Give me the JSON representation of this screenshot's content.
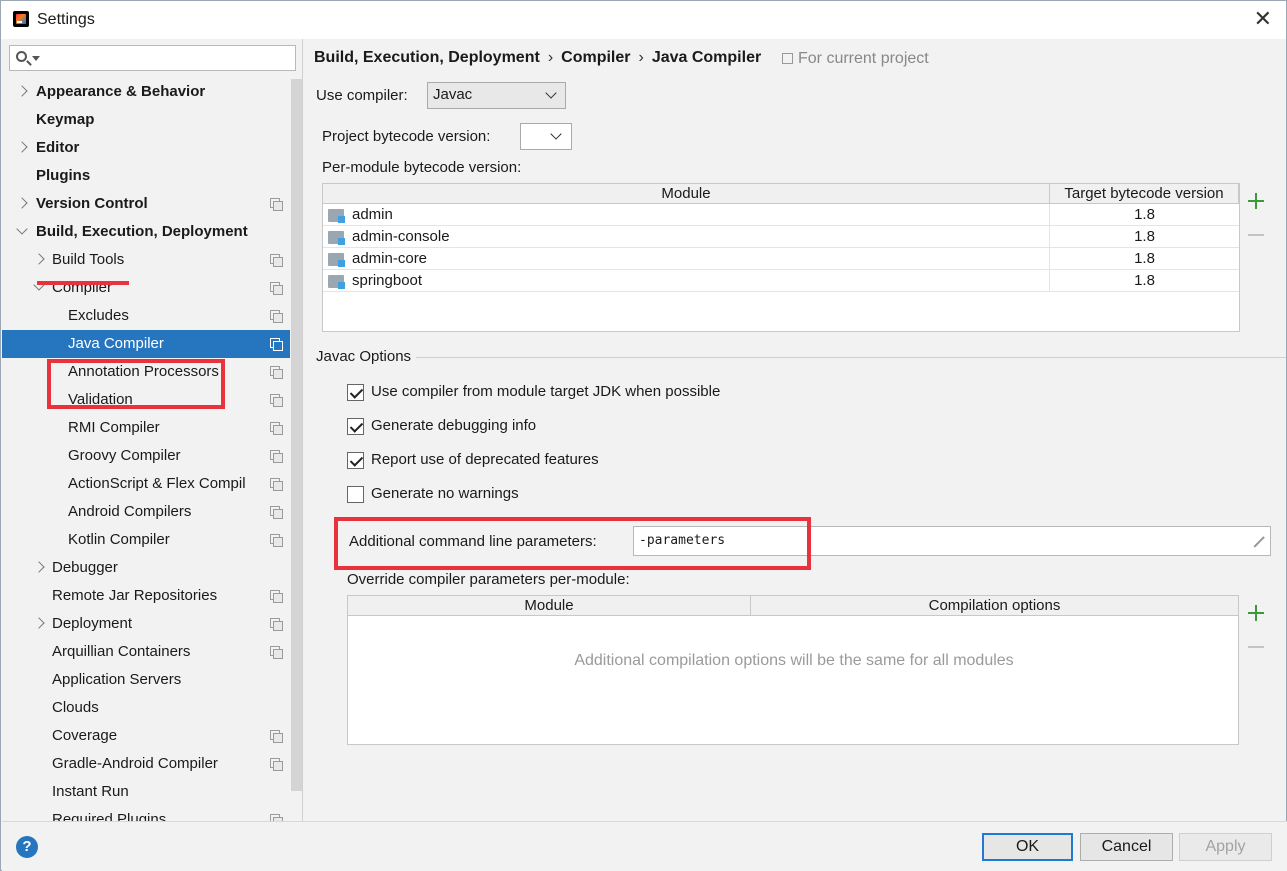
{
  "window": {
    "title": "Settings"
  },
  "sidebar": {
    "items": [
      {
        "label": "Appearance & Behavior",
        "level": 0,
        "arrow": "right",
        "bold": true,
        "copy": false
      },
      {
        "label": "Keymap",
        "level": 0,
        "arrow": "none",
        "bold": true,
        "copy": false
      },
      {
        "label": "Editor",
        "level": 0,
        "arrow": "right",
        "bold": true,
        "copy": false
      },
      {
        "label": "Plugins",
        "level": 0,
        "arrow": "none",
        "bold": true,
        "copy": false
      },
      {
        "label": "Version Control",
        "level": 0,
        "arrow": "right",
        "bold": true,
        "copy": true
      },
      {
        "label": "Build, Execution, Deployment",
        "level": 0,
        "arrow": "down",
        "bold": true,
        "copy": false
      },
      {
        "label": "Build Tools",
        "level": 1,
        "arrow": "right",
        "bold": false,
        "copy": true
      },
      {
        "label": "Compiler",
        "level": 1,
        "arrow": "down",
        "bold": false,
        "copy": true
      },
      {
        "label": "Excludes",
        "level": 2,
        "arrow": "none",
        "bold": false,
        "copy": true
      },
      {
        "label": "Java Compiler",
        "level": 2,
        "arrow": "none",
        "bold": false,
        "copy": true,
        "selected": true
      },
      {
        "label": "Annotation Processors",
        "level": 2,
        "arrow": "none",
        "bold": false,
        "copy": true
      },
      {
        "label": "Validation",
        "level": 2,
        "arrow": "none",
        "bold": false,
        "copy": true
      },
      {
        "label": "RMI Compiler",
        "level": 2,
        "arrow": "none",
        "bold": false,
        "copy": true
      },
      {
        "label": "Groovy Compiler",
        "level": 2,
        "arrow": "none",
        "bold": false,
        "copy": true
      },
      {
        "label": "ActionScript & Flex Compil",
        "level": 2,
        "arrow": "none",
        "bold": false,
        "copy": true
      },
      {
        "label": "Android Compilers",
        "level": 2,
        "arrow": "none",
        "bold": false,
        "copy": true
      },
      {
        "label": "Kotlin Compiler",
        "level": 2,
        "arrow": "none",
        "bold": false,
        "copy": true
      },
      {
        "label": "Debugger",
        "level": 1,
        "arrow": "right",
        "bold": false,
        "copy": false
      },
      {
        "label": "Remote Jar Repositories",
        "level": 1,
        "arrow": "none",
        "bold": false,
        "copy": true
      },
      {
        "label": "Deployment",
        "level": 1,
        "arrow": "right",
        "bold": false,
        "copy": true
      },
      {
        "label": "Arquillian Containers",
        "level": 1,
        "arrow": "none",
        "bold": false,
        "copy": true
      },
      {
        "label": "Application Servers",
        "level": 1,
        "arrow": "none",
        "bold": false,
        "copy": false
      },
      {
        "label": "Clouds",
        "level": 1,
        "arrow": "none",
        "bold": false,
        "copy": false
      },
      {
        "label": "Coverage",
        "level": 1,
        "arrow": "none",
        "bold": false,
        "copy": true
      },
      {
        "label": "Gradle-Android Compiler",
        "level": 1,
        "arrow": "none",
        "bold": false,
        "copy": true
      },
      {
        "label": "Instant Run",
        "level": 1,
        "arrow": "none",
        "bold": false,
        "copy": false
      },
      {
        "label": "Required Plugins",
        "level": 1,
        "arrow": "none",
        "bold": false,
        "copy": true
      }
    ]
  },
  "breadcrumb": {
    "part1": "Build, Execution, Deployment",
    "part2": "Compiler",
    "part3": "Java Compiler",
    "sep": "›"
  },
  "for_project": "For current project",
  "compiler": {
    "use_label": "Use compiler:",
    "use_value": "Javac",
    "bytecode_label": "Project bytecode version:",
    "bytecode_value": "",
    "per_module_label": "Per-module bytecode version:"
  },
  "module_table": {
    "col_module": "Module",
    "col_target": "Target bytecode version",
    "rows": [
      {
        "module": "admin",
        "target": "1.8"
      },
      {
        "module": "admin-console",
        "target": "1.8"
      },
      {
        "module": "admin-core",
        "target": "1.8"
      },
      {
        "module": "springboot",
        "target": "1.8"
      }
    ]
  },
  "javac": {
    "section_title": "Javac Options",
    "options": [
      {
        "label": "Use compiler from module target JDK when possible",
        "checked": true
      },
      {
        "label": "Generate debugging info",
        "checked": true
      },
      {
        "label": "Report use of deprecated features",
        "checked": true
      },
      {
        "label": "Generate no warnings",
        "checked": false
      }
    ],
    "params_label": "Additional command line parameters:",
    "params_value": "-parameters",
    "override_label": "Override compiler parameters per-module:"
  },
  "override_table": {
    "col_module": "Module",
    "col_options": "Compilation options",
    "empty_text": "Additional compilation options will be the same for all modules"
  },
  "footer": {
    "ok": "OK",
    "cancel": "Cancel",
    "apply": "Apply",
    "help": "?"
  },
  "colors": {
    "selection": "#2675bf",
    "highlight_red": "#e8323c",
    "plus_green": "#3a9a3a"
  },
  "icons": [
    "search-icon",
    "close-icon",
    "copy-icon",
    "folder-icon",
    "plus-icon",
    "minus-icon",
    "expand-icon",
    "help-icon"
  ]
}
